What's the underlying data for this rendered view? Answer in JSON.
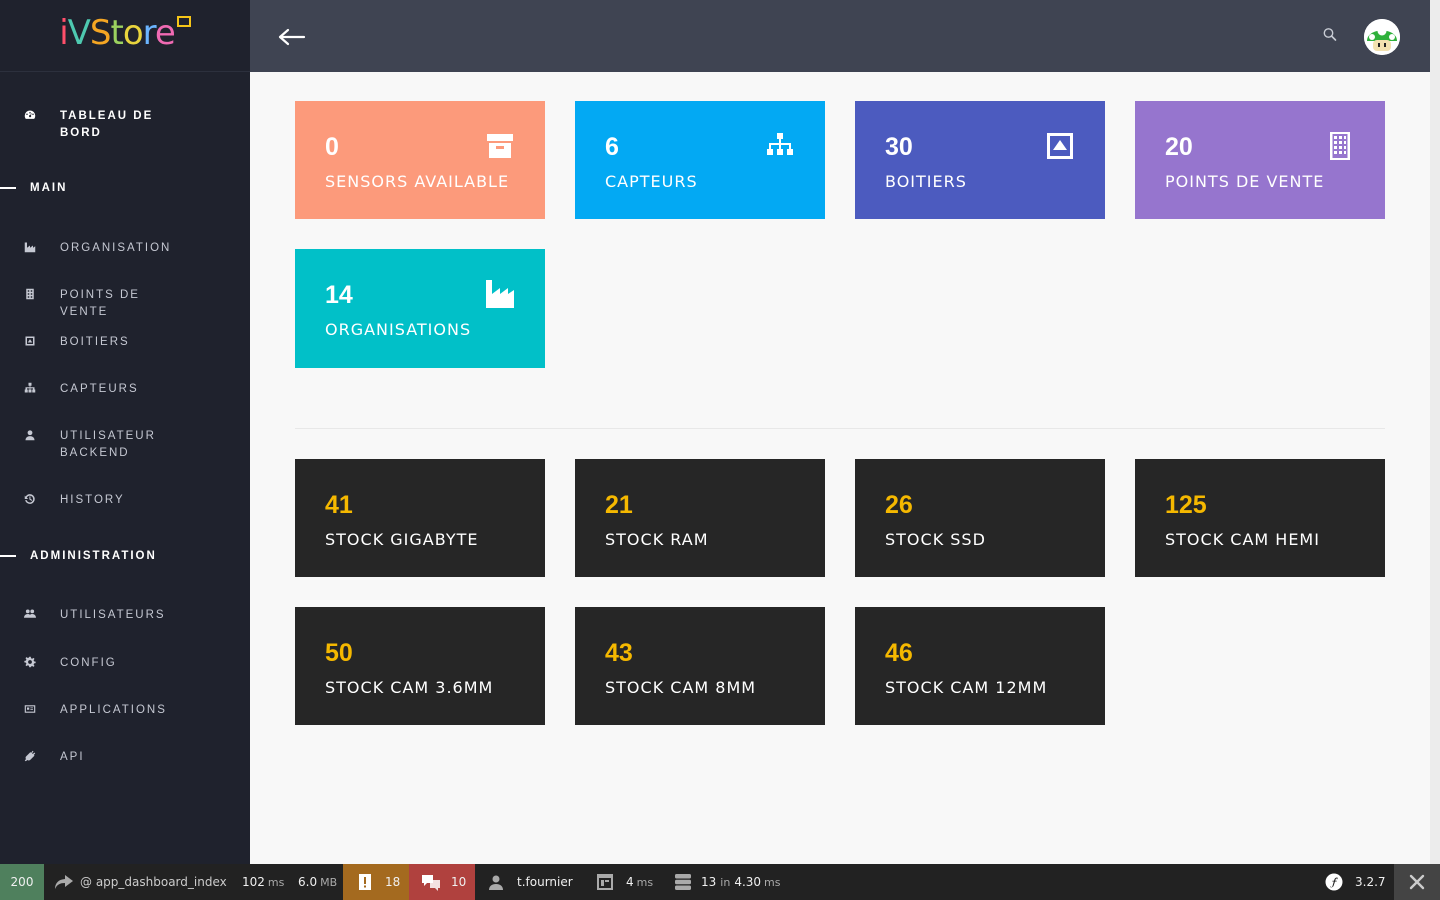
{
  "brand": {
    "name": "iVStore"
  },
  "sidebar": {
    "dashboard": {
      "label": "Tableau de bord",
      "icon": "dashboard-icon"
    },
    "sections": [
      {
        "title": "Main"
      },
      {
        "title": "Administration"
      }
    ],
    "main_items": [
      {
        "label": "Organisation",
        "icon": "industry-icon"
      },
      {
        "label": "Points de vente",
        "icon": "building-icon"
      },
      {
        "label": "Boitiers",
        "icon": "box-icon"
      },
      {
        "label": "Capteurs",
        "icon": "sitemap-icon"
      },
      {
        "label": "Utilisateur backend",
        "icon": "user-icon"
      },
      {
        "label": "History",
        "icon": "history-icon"
      }
    ],
    "admin_items": [
      {
        "label": "Utilisateurs",
        "icon": "users-icon"
      },
      {
        "label": "Config",
        "icon": "gear-icon"
      },
      {
        "label": "Applications",
        "icon": "id-card-icon"
      },
      {
        "label": "API",
        "icon": "plug-icon"
      }
    ]
  },
  "header": {
    "back_icon": "arrow-left-icon",
    "search_icon": "search-icon",
    "avatar": "mushroom-avatar"
  },
  "stat_cards": [
    {
      "value": "0",
      "label": "Sensors available",
      "color": "#fc9a7b",
      "icon": "archive-icon"
    },
    {
      "value": "6",
      "label": "Capteurs",
      "color": "#03a9f3",
      "icon": "sitemap-icon"
    },
    {
      "value": "30",
      "label": "Boitiers",
      "color": "#4c5bbf",
      "icon": "caret-square-up-icon"
    },
    {
      "value": "20",
      "label": "Points de vente",
      "color": "#9675ce",
      "icon": "building-icon"
    },
    {
      "value": "14",
      "label": "Organisations",
      "color": "#01c0c8",
      "icon": "industry-icon"
    }
  ],
  "stock_cards": [
    {
      "value": "41",
      "label": "Stock GIGABYTE"
    },
    {
      "value": "21",
      "label": "Stock RAM"
    },
    {
      "value": "26",
      "label": "Stock SSD"
    },
    {
      "value": "125",
      "label": "Stock CAM HEMI"
    },
    {
      "value": "50",
      "label": "Stock CAM 3.6MM"
    },
    {
      "value": "43",
      "label": "Stock CAM 8MM"
    },
    {
      "value": "46",
      "label": "Stock CAM 12MM"
    }
  ],
  "toolbar": {
    "status": "200",
    "status_color": "#4f805d",
    "route": "@ app_dashboard_index",
    "time_value": "102",
    "time_unit": "ms",
    "memory_value": "6.0",
    "memory_unit": "MB",
    "warnings": "18",
    "warnings_color": "#a46a1f",
    "errors": "10",
    "errors_color": "#b0413e",
    "user": "t.fournier",
    "twig_time": "4",
    "twig_unit": "ms",
    "db_queries": "13",
    "db_in": "in",
    "db_time": "4.30",
    "db_unit": "ms",
    "symfony_version": "3.2.7"
  }
}
